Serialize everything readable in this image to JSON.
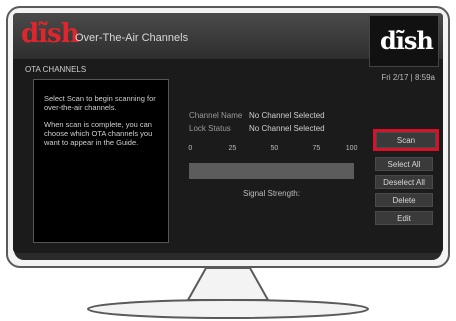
{
  "header": {
    "logo_text": "dĩsh",
    "title": "Over-The-Air Channels",
    "logo_text_dark": "dĩsh"
  },
  "section": {
    "label": "OTA CHANNELS",
    "datetime": "Fri 2/17 | 8:59a"
  },
  "info": {
    "para1": "Select Scan to begin scanning for over-the-air channels.",
    "para2": "When scan is complete, you can choose which OTA channels you want to appear in the Guide."
  },
  "fields": {
    "channel_name_label": "Channel Name",
    "channel_name_value": "No Channel Selected",
    "lock_status_label": "Lock Status",
    "lock_status_value": "No Channel Selected"
  },
  "signal": {
    "ticks": [
      "0",
      "25",
      "50",
      "75",
      "100"
    ],
    "label": "Signal Strength:",
    "level_percent": 0
  },
  "buttons": {
    "scan": "Scan",
    "select_all": "Select All",
    "deselect_all": "Deselect All",
    "delete": "Delete",
    "edit": "Edit"
  },
  "colors": {
    "brand_red": "#e0262d",
    "scan_highlight": "#d6122a"
  }
}
